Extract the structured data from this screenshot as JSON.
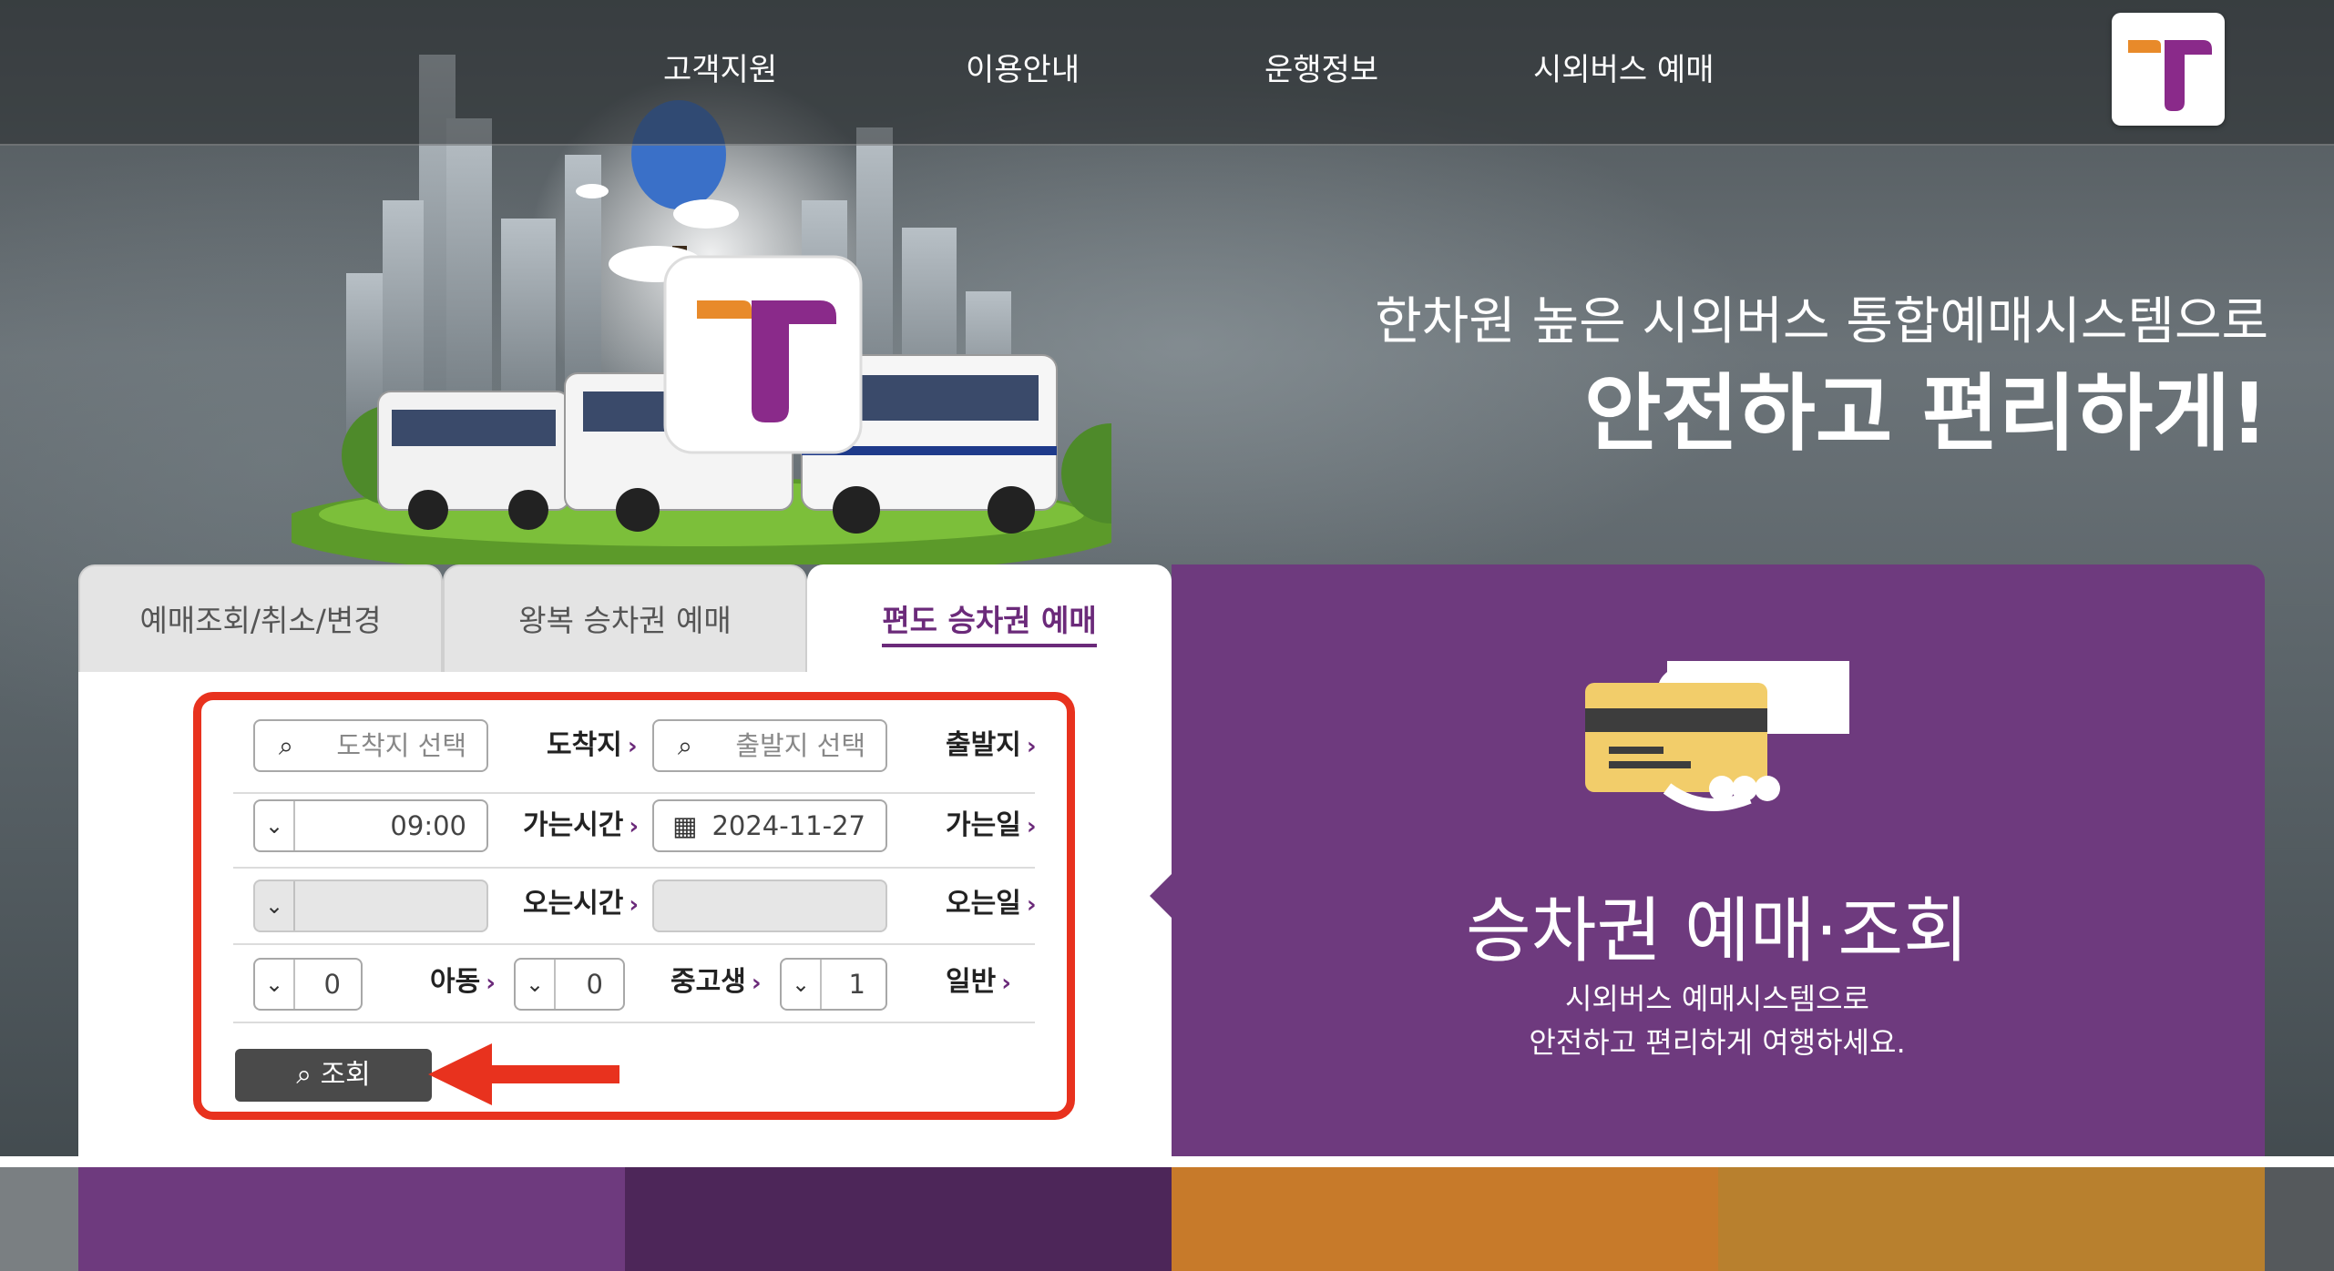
{
  "nav": {
    "items": [
      "고객지원",
      "이용안내",
      "운행정보",
      "시외버스 예매"
    ]
  },
  "hero": {
    "line1": "한차원 높은 시외버스 통합예매시스템으로",
    "line2": "안전하고 편리하게!"
  },
  "tabs": [
    {
      "label": "예매조회/취소/변경"
    },
    {
      "label": "왕복 승차권 예매"
    },
    {
      "label": "편도 승차권 예매"
    }
  ],
  "form": {
    "departure_label": "출발지",
    "departure_placeholder": "출발지 선택",
    "arrival_label": "도착지",
    "arrival_placeholder": "도착지 선택",
    "go_date_label": "가는일",
    "go_date_value": "2024-11-27",
    "go_time_label": "가는시간",
    "go_time_value": "09:00",
    "return_date_label": "오는일",
    "return_time_label": "오는시간",
    "adult_label": "일반",
    "adult_value": "1",
    "student_label": "중고생",
    "student_value": "0",
    "child_label": "아동",
    "child_value": "0",
    "search_button": "조회"
  },
  "info": {
    "title": "승차권 예매·조회",
    "sub1": "시외버스 예매시스템으로",
    "sub2": "안전하고 편리하게 여행하세요."
  },
  "icons": {
    "search": "search-icon",
    "calendar": "calendar-icon",
    "dropdown": "chevron-down-icon"
  },
  "colors": {
    "brand_purple": "#6e3a7e",
    "highlight_red": "#e8321e",
    "logo_orange": "#e88a2a"
  }
}
